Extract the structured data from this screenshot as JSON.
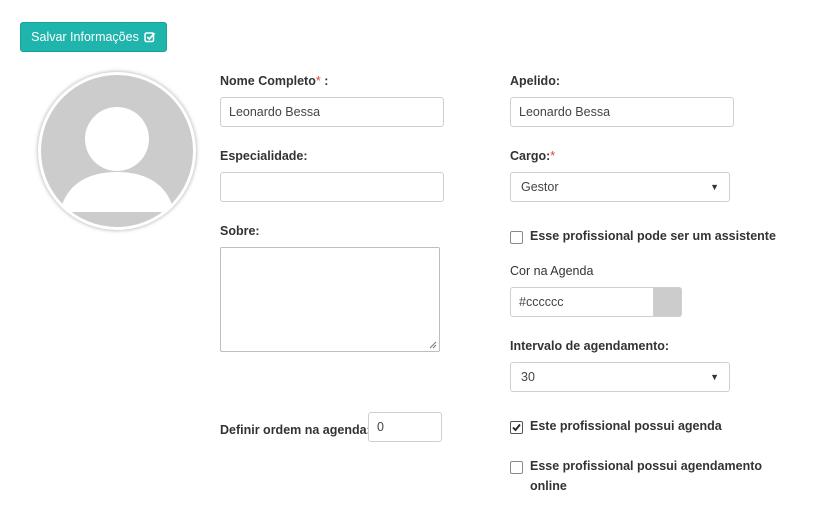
{
  "toolbar": {
    "save_label": "Salvar Informações"
  },
  "icons": {
    "save": "check-square-icon",
    "avatar": "user-silhouette-icon",
    "select_caret": "caret-down-icon",
    "checkbox_check": "checkmark-icon"
  },
  "colors": {
    "accent": "#1fb5ac",
    "required_marker": "#e04040",
    "agenda_color": "#cccccc"
  },
  "form": {
    "nome": {
      "label": "Nome Completo",
      "required_mark": "*",
      "suffix": " :",
      "value": "Leonardo Bessa"
    },
    "apelido": {
      "label": "Apelido:",
      "value": "Leonardo Bessa"
    },
    "especialidade": {
      "label": "Especialidade:",
      "value": ""
    },
    "cargo": {
      "label": "Cargo:",
      "required_mark": "*",
      "selected": "Gestor"
    },
    "sobre": {
      "label": "Sobre:",
      "value": ""
    },
    "assistente": {
      "label": "Esse profissional pode ser um assistente",
      "checked": false
    },
    "cor": {
      "label": "Cor na Agenda",
      "value": "#cccccc"
    },
    "intervalo": {
      "label": "Intervalo de agendamento:",
      "selected": "30"
    },
    "ordem": {
      "label": "Definir ordem na agenda:",
      "value": "0"
    },
    "possui_agenda": {
      "label": "Este profissional possui agenda",
      "checked": true
    },
    "online": {
      "label_line1": "Esse profissional possui agendamento",
      "label_line2": "online",
      "checked": false
    }
  }
}
